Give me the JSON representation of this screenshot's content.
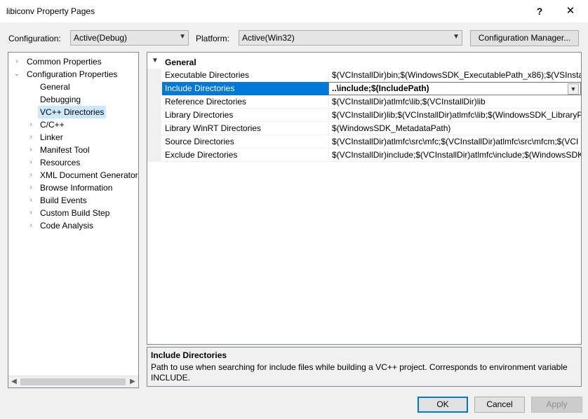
{
  "window": {
    "title": "libiconv Property Pages",
    "help_glyph": "?",
    "close_glyph": "✕"
  },
  "toolbar": {
    "configuration_label": "Configuration:",
    "configuration_value": "Active(Debug)",
    "platform_label": "Platform:",
    "platform_value": "Active(Win32)",
    "config_manager_label": "Configuration Manager..."
  },
  "tree": {
    "items": [
      {
        "label": "Common Properties",
        "expander": "›"
      },
      {
        "label": "Configuration Properties",
        "expander": "⌄"
      },
      {
        "label": "General",
        "expander": ""
      },
      {
        "label": "Debugging",
        "expander": ""
      },
      {
        "label": "VC++ Directories",
        "expander": ""
      },
      {
        "label": "C/C++",
        "expander": "›"
      },
      {
        "label": "Linker",
        "expander": "›"
      },
      {
        "label": "Manifest Tool",
        "expander": "›"
      },
      {
        "label": "Resources",
        "expander": "›"
      },
      {
        "label": "XML Document Generator",
        "expander": "›"
      },
      {
        "label": "Browse Information",
        "expander": "›"
      },
      {
        "label": "Build Events",
        "expander": "›"
      },
      {
        "label": "Custom Build Step",
        "expander": "›"
      },
      {
        "label": "Code Analysis",
        "expander": "›"
      }
    ],
    "selected_item": "VC++ Directories"
  },
  "grid": {
    "category": "General",
    "rows": [
      {
        "name": "Executable Directories",
        "value": "$(VCInstallDir)bin;$(WindowsSDK_ExecutablePath_x86);$(VSInstallDi"
      },
      {
        "name": "Include Directories",
        "value": "..\\include;$(IncludePath)"
      },
      {
        "name": "Reference Directories",
        "value": "$(VCInstallDir)atlmfc\\lib;$(VCInstallDir)lib"
      },
      {
        "name": "Library Directories",
        "value": "$(VCInstallDir)lib;$(VCInstallDir)atlmfc\\lib;$(WindowsSDK_LibraryPa"
      },
      {
        "name": "Library WinRT Directories",
        "value": "$(WindowsSDK_MetadataPath)"
      },
      {
        "name": "Source Directories",
        "value": "$(VCInstallDir)atlmfc\\src\\mfc;$(VCInstallDir)atlmfc\\src\\mfcm;$(VCI"
      },
      {
        "name": "Exclude Directories",
        "value": "$(VCInstallDir)include;$(VCInstallDir)atlmfc\\include;$(WindowsSDK_"
      }
    ],
    "selected_row": "Include Directories"
  },
  "description": {
    "title": "Include Directories",
    "text": "Path to use when searching for include files while building a VC++ project.  Corresponds to environment variable INCLUDE."
  },
  "buttons": {
    "ok": "OK",
    "cancel": "Cancel",
    "apply": "Apply"
  },
  "colors": {
    "selection": "#0078d7",
    "tree_selection": "#cce8ff"
  }
}
